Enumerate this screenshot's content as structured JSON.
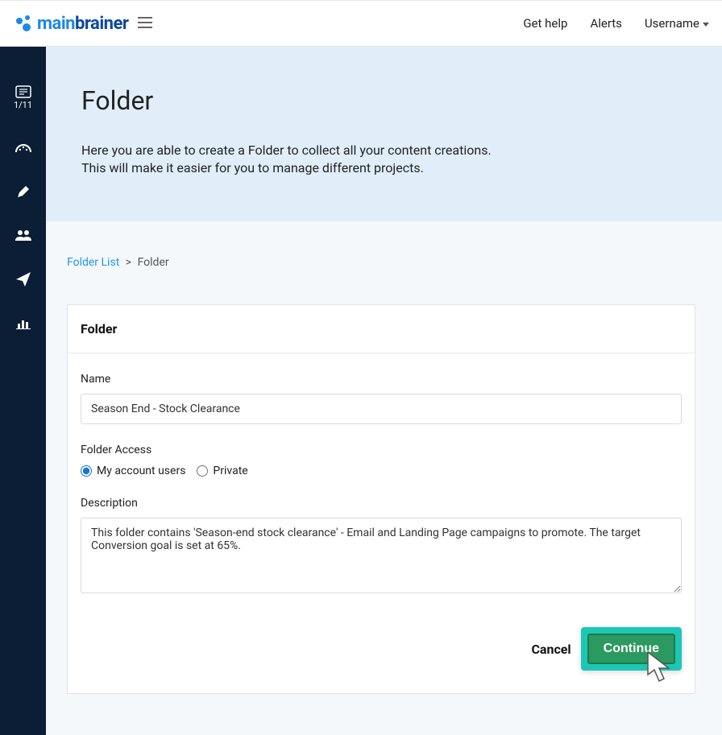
{
  "topbar": {
    "logo_main": "main",
    "logo_brainer": "brainer",
    "get_help": "Get help",
    "alerts": "Alerts",
    "username": "Username"
  },
  "sidebar": {
    "progress": "1/11"
  },
  "banner": {
    "title": "Folder",
    "line1": "Here you are able to create a Folder to collect all your content creations.",
    "line2": "This will make it easier for you to manage different projects."
  },
  "breadcrumb": {
    "link": "Folder List",
    "sep": ">",
    "current": "Folder"
  },
  "card": {
    "header": "Folder",
    "name_label": "Name",
    "name_value": "Season End - Stock Clearance",
    "access_label": "Folder Access",
    "radio_account": "My account users",
    "radio_private": "Private",
    "desc_label": "Description",
    "desc_value": "This folder contains 'Season-end stock clearance' - Email and Landing Page campaigns to promote. The target Conversion goal is set at 65%.",
    "cancel": "Cancel",
    "continue": "Continue"
  }
}
